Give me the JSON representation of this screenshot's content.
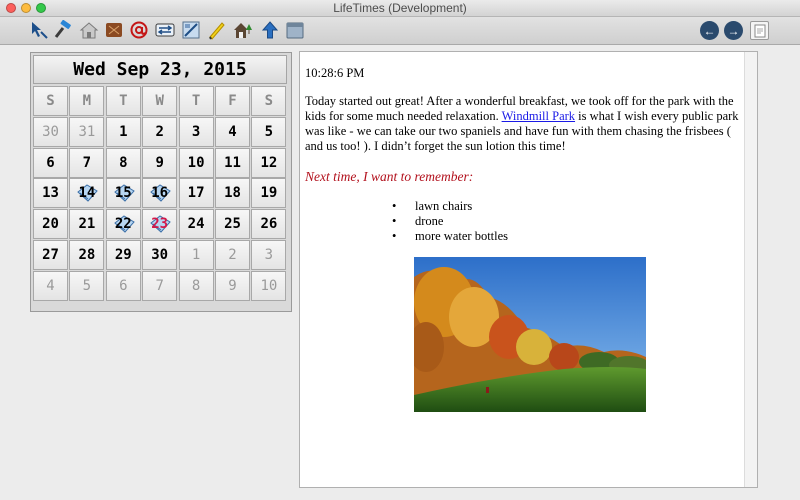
{
  "window": {
    "title": "LifeTimes (Development)"
  },
  "toolbar": {
    "icons": [
      "pointer-tool-icon",
      "hammer-icon",
      "house-icon",
      "leather-book-icon",
      "at-sign-icon",
      "link-icon",
      "palette-icon",
      "pencil-icon",
      "home-tree-icon",
      "upload-icon",
      "archive-icon"
    ],
    "nav": {
      "back": "←",
      "forward": "→"
    }
  },
  "calendar": {
    "header": "Wed Sep 23, 2015",
    "weekdays": [
      "S",
      "M",
      "T",
      "W",
      "T",
      "F",
      "S"
    ],
    "weeks": [
      [
        {
          "d": "30",
          "m": true
        },
        {
          "d": "31",
          "m": true
        },
        {
          "d": "1"
        },
        {
          "d": "2"
        },
        {
          "d": "3"
        },
        {
          "d": "4"
        },
        {
          "d": "5"
        }
      ],
      [
        {
          "d": "6"
        },
        {
          "d": "7"
        },
        {
          "d": "8"
        },
        {
          "d": "9"
        },
        {
          "d": "10"
        },
        {
          "d": "11"
        },
        {
          "d": "12"
        }
      ],
      [
        {
          "d": "13"
        },
        {
          "d": "14",
          "e": true
        },
        {
          "d": "15",
          "e": true
        },
        {
          "d": "16",
          "e": true
        },
        {
          "d": "17"
        },
        {
          "d": "18"
        },
        {
          "d": "19"
        }
      ],
      [
        {
          "d": "20"
        },
        {
          "d": "21"
        },
        {
          "d": "22",
          "e": true
        },
        {
          "d": "23",
          "e": true,
          "t": true
        },
        {
          "d": "24"
        },
        {
          "d": "25"
        },
        {
          "d": "26"
        }
      ],
      [
        {
          "d": "27"
        },
        {
          "d": "28"
        },
        {
          "d": "29"
        },
        {
          "d": "30"
        },
        {
          "d": "1",
          "m": true
        },
        {
          "d": "2",
          "m": true
        },
        {
          "d": "3",
          "m": true
        }
      ],
      [
        {
          "d": "4",
          "m": true
        },
        {
          "d": "5",
          "m": true
        },
        {
          "d": "6",
          "m": true
        },
        {
          "d": "7",
          "m": true
        },
        {
          "d": "8",
          "m": true
        },
        {
          "d": "9",
          "m": true
        },
        {
          "d": "10",
          "m": true
        }
      ]
    ]
  },
  "entry": {
    "time": "10:28:6 PM",
    "paragraph_before_link": "Today started out great!  After a wonderful breakfast, we took off for the park with the kids for some much needed relaxation.  ",
    "link": "Windmill Park",
    "paragraph_after_link": " is what I wish every public park was like - we can take our two spaniels and have fun with them chasing the frisbees ( and us too! ).  I didn’t forget the sun lotion this time!",
    "remember": "Next time, I want to remember:",
    "list": [
      "lawn chairs",
      "drone",
      "more water bottles"
    ]
  }
}
